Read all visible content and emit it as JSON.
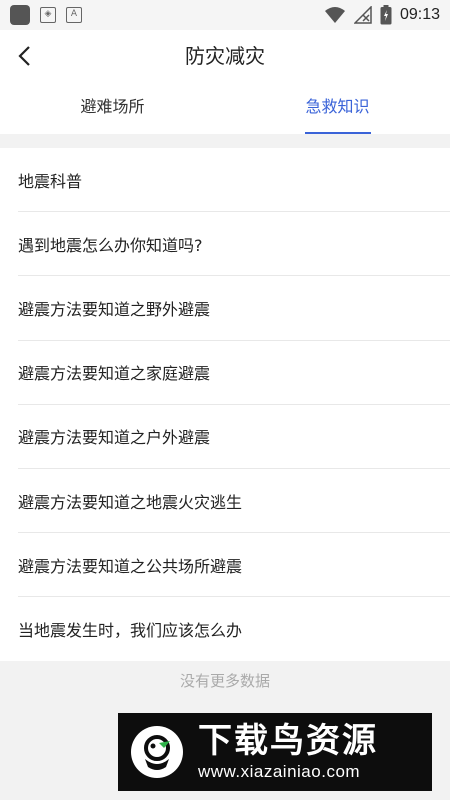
{
  "status_bar": {
    "time": "09:13"
  },
  "header": {
    "title": "防灾减灾"
  },
  "tabs": [
    {
      "label": "避难场所",
      "active": false
    },
    {
      "label": "急救知识",
      "active": true
    }
  ],
  "list": {
    "items": [
      "地震科普",
      "遇到地震怎么办你知道吗?",
      "避震方法要知道之野外避震",
      "避震方法要知道之家庭避震",
      "避震方法要知道之户外避震",
      "避震方法要知道之地震火灾逃生",
      "避震方法要知道之公共场所避震",
      "当地震发生时，我们应该怎么办"
    ]
  },
  "footer": {
    "no_more": "没有更多数据"
  },
  "watermark": {
    "brand": "下载鸟资源",
    "url": "www.xiazainiao.com"
  },
  "colors": {
    "accent": "#3a63d8"
  }
}
